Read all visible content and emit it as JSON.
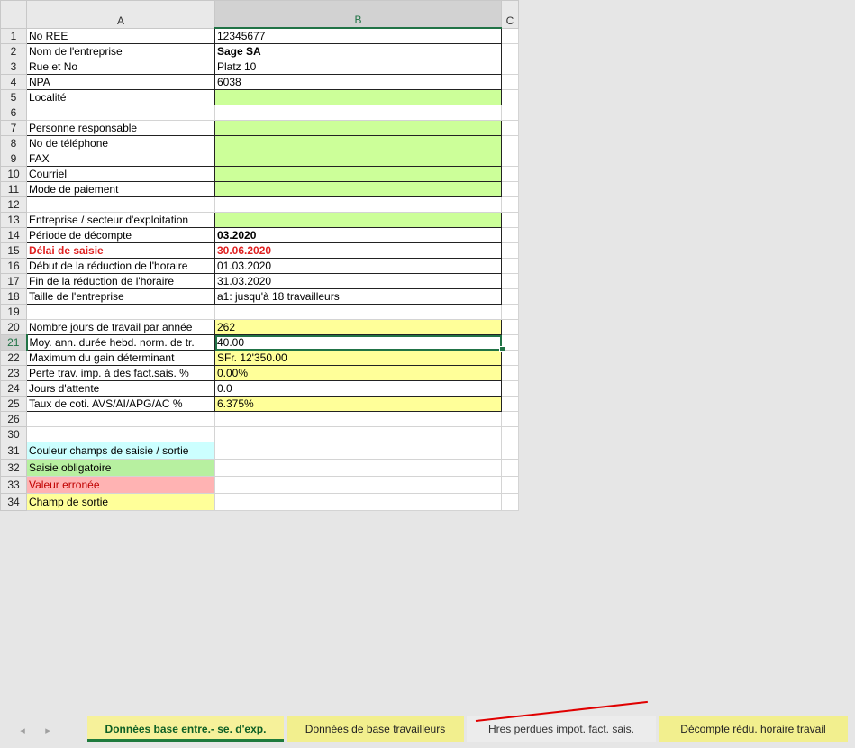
{
  "columns": {
    "a": "A",
    "b": "B",
    "c": "C"
  },
  "rows": [
    {
      "n": "1",
      "label": "No REE",
      "value": "12345677",
      "style": "white"
    },
    {
      "n": "2",
      "label": "Nom de l'entreprise",
      "value": "Sage SA",
      "style": "white",
      "bold": true
    },
    {
      "n": "3",
      "label": "Rue et No",
      "value": "Platz 10",
      "style": "white"
    },
    {
      "n": "4",
      "label": "NPA",
      "value": "6038",
      "style": "white"
    },
    {
      "n": "5",
      "label": "Localité",
      "value": "",
      "style": "green"
    },
    {
      "n": "6",
      "label": "",
      "value": "",
      "style": "empty"
    },
    {
      "n": "7",
      "label": "Personne responsable",
      "value": "",
      "style": "green"
    },
    {
      "n": "8",
      "label": "No de téléphone",
      "value": "",
      "style": "green"
    },
    {
      "n": "9",
      "label": "FAX",
      "value": "",
      "style": "green"
    },
    {
      "n": "10",
      "label": "Courriel",
      "value": "",
      "style": "green"
    },
    {
      "n": "11",
      "label": "Mode de paiement",
      "value": "",
      "style": "green"
    },
    {
      "n": "12",
      "label": "",
      "value": "",
      "style": "empty"
    },
    {
      "n": "13",
      "label": "Entreprise / secteur d'exploitation",
      "value": "",
      "style": "green"
    },
    {
      "n": "14",
      "label": "Période de décompte",
      "value": "03.2020",
      "style": "white",
      "bold": true
    },
    {
      "n": "15",
      "label": "Délai de saisie",
      "value": "30.06.2020",
      "style": "white",
      "red": true
    },
    {
      "n": "16",
      "label": "Début de la réduction de l'horaire",
      "value": "01.03.2020",
      "style": "white"
    },
    {
      "n": "17",
      "label": "Fin de la réduction de l'horaire",
      "value": "31.03.2020",
      "style": "white"
    },
    {
      "n": "18",
      "label": "Taille de l'entreprise",
      "value": "a1: jusqu'à 18 travailleurs",
      "style": "white"
    },
    {
      "n": "19",
      "label": "",
      "value": "",
      "style": "empty"
    },
    {
      "n": "20",
      "label": "Nombre jours de travail par année",
      "value": "262",
      "style": "yellow"
    },
    {
      "n": "21",
      "label": "Moy. ann. durée hebd. norm. de tr.",
      "value": "40.00",
      "style": "selected"
    },
    {
      "n": "22",
      "label": "Maximum du gain déterminant",
      "value": "SFr. 12'350.00",
      "style": "yellow"
    },
    {
      "n": "23",
      "label": "Perte trav. imp. à des fact.sais. %",
      "value": "0.00%",
      "style": "yellow"
    },
    {
      "n": "24",
      "label": "Jours d'attente",
      "value": "0.0",
      "style": "white"
    },
    {
      "n": "25",
      "label": "Taux de coti. AVS/AI/APG/AC %",
      "value": "6.375%",
      "style": "yellow"
    },
    {
      "n": "26",
      "label": "",
      "value": "",
      "style": "empty"
    },
    {
      "n": "30",
      "label": "",
      "value": "",
      "style": "empty"
    }
  ],
  "legend": [
    {
      "n": "31",
      "label": "Couleur champs de saisie / sortie",
      "style": "cyan"
    },
    {
      "n": "32",
      "label": "Saisie obligatoire",
      "style": "lgreen"
    },
    {
      "n": "33",
      "label": "Valeur erronée",
      "style": "pink"
    },
    {
      "n": "34",
      "label": "Champ de sortie",
      "style": "yellow"
    }
  ],
  "tabs": [
    {
      "label": "Données base entre.- se. d'exp.",
      "state": "active"
    },
    {
      "label": "Données de base travailleurs",
      "state": "yellow"
    },
    {
      "label": "Hres perdues impot. fact. sais.",
      "state": "plain"
    },
    {
      "label": "Décompte rédu. horaire travail",
      "state": "yellow"
    }
  ],
  "colors": {
    "input_green": "#ccff99",
    "output_yellow": "#ffff99",
    "selection": "#217346",
    "alert_red": "#e02020"
  }
}
